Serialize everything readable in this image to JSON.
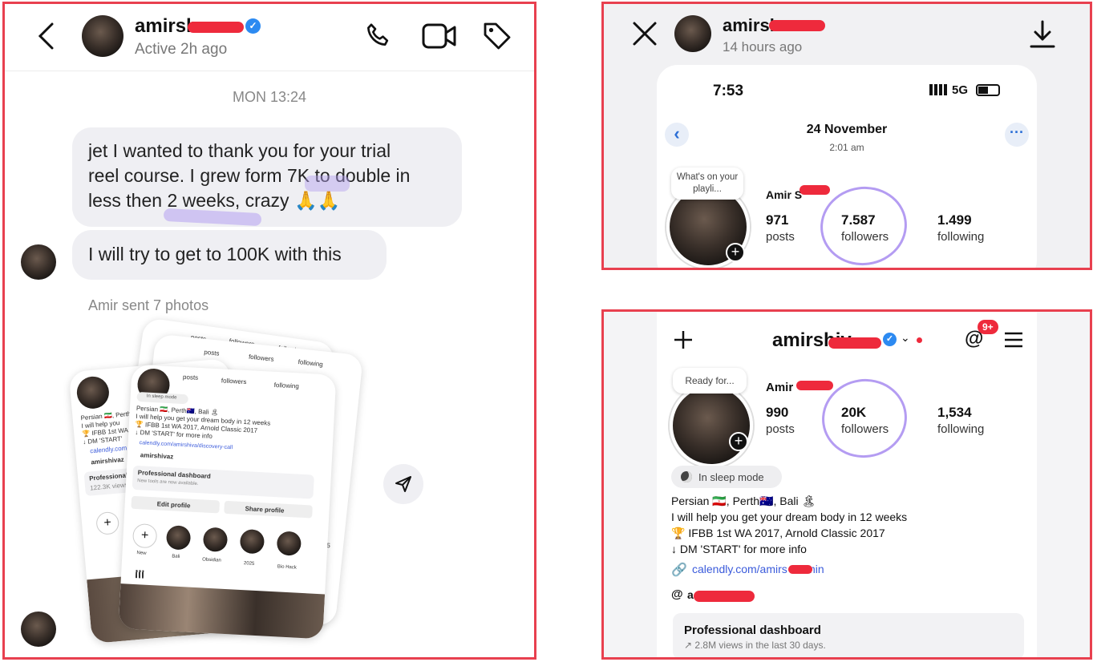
{
  "chat": {
    "header": {
      "username": "amirsh",
      "status": "Active 2h ago"
    },
    "date_label": "MON 13:24",
    "messages": [
      {
        "text_lines": [
          "jet I wanted to thank you for your trial",
          "reel course. I grew form 7K to double in",
          "less then 2 weeks, crazy 🙏🙏"
        ]
      },
      {
        "text_lines": [
          "I will try to get to 100K with this"
        ]
      }
    ],
    "sent_photos_label": "Amir sent 7 photos",
    "front_card": {
      "stats": [
        "posts",
        "followers",
        "following"
      ],
      "sleep_badge": "In sleep mode",
      "bio": [
        "Persian 🇮🇷, Perth🇦🇺, Bali 🏝",
        "I will help you get your dream body in 12 weeks",
        "🏆 IFBB 1st WA 2017, Arnold Classic 2017",
        "↓ DM 'START' for more info"
      ],
      "link": "calendly.com/amirshiva/discovery-call",
      "threads": "amirshivaz",
      "dashboard_title": "Professional dashboard",
      "dashboard_sub": "New tools are now available.",
      "edit_profile": "Edit profile",
      "share_profile": "Share profile",
      "highlights": [
        "New",
        "Bali",
        "Obsidian",
        "2025",
        "Bio Hack"
      ]
    },
    "back_card": {
      "bio": [
        "Persian 🇮🇷, Perth",
        "I will help you",
        "🏆 IFBB 1st WA",
        "↓ DM 'START'"
      ],
      "link": "calendly.com",
      "threads": "amirshivaz",
      "dashboard_title": "Professional",
      "dashboard_sub": "122.3K views",
      "highlight_year": "2025"
    }
  },
  "story_view": {
    "username": "amirsh",
    "time_ago": "14 hours ago",
    "phone_time": "7:53",
    "network": "5G",
    "date": "24 November",
    "time": "2:01 am",
    "note": "What's on your playli...",
    "name": "Amir S",
    "posts": "971",
    "posts_label": "posts",
    "followers": "7.587",
    "followers_label": "followers",
    "following": "1.499",
    "following_label": "following"
  },
  "profile_view": {
    "username": "amirshiv",
    "notif_badge": "9+",
    "note": "Ready for...",
    "name": "Amir",
    "posts": "990",
    "posts_label": "posts",
    "followers": "20K",
    "followers_label": "followers",
    "following": "1,534",
    "following_label": "following",
    "sleep_badge": "In sleep mode",
    "bio": [
      "Persian 🇮🇷, Perth🇦🇺, Bali 🏝",
      "I will help you get your dream body in 12 weeks",
      "🏆 IFBB 1st WA 2017, Arnold Classic 2017",
      "↓ DM 'START' for more info"
    ],
    "link": "calendly.com/amirs  /45min",
    "threads": "a",
    "dashboard_title": "Professional dashboard",
    "dashboard_sub": "↗ 2.8M views in the last 30 days."
  },
  "colors": {
    "border": "#e8404f",
    "redact": "#ee2a3c",
    "circle": "#b49cf2",
    "link": "#3b5bdb",
    "verified": "#2c8af1"
  }
}
